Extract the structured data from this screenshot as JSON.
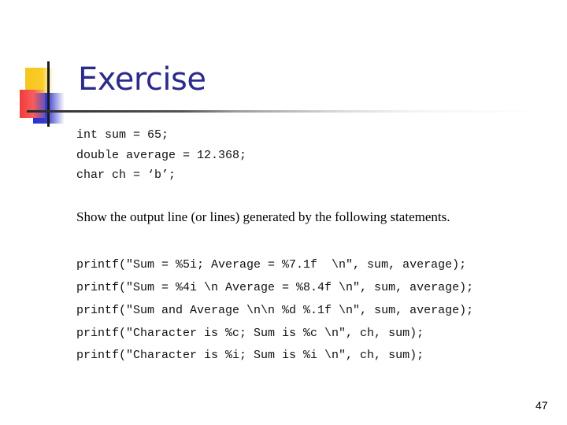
{
  "slide": {
    "title": "Exercise",
    "declarations": [
      "int sum = 65;",
      "double average = 12.368;",
      "char ch = ‘b’;"
    ],
    "instruction": "Show the output line (or lines) generated by the following statements.",
    "statements": [
      "printf(\"Sum = %5i; Average = %7.1f  \\n\", sum, average);",
      "printf(\"Sum = %4i \\n Average = %8.4f \\n\", sum, average);",
      "printf(\"Sum and Average \\n\\n %d %.1f \\n\", sum, average);",
      "printf(\"Character is %c; Sum is %c \\n\", ch, sum);",
      "printf(\"Character is %i; Sum is %i \\n\", ch, sum);"
    ],
    "page_number": "47"
  },
  "colors": {
    "title": "#2b2b8c",
    "accent_yellow": "#f7c51f",
    "accent_red": "#f23a3a",
    "accent_blue": "#2a2fc9"
  }
}
